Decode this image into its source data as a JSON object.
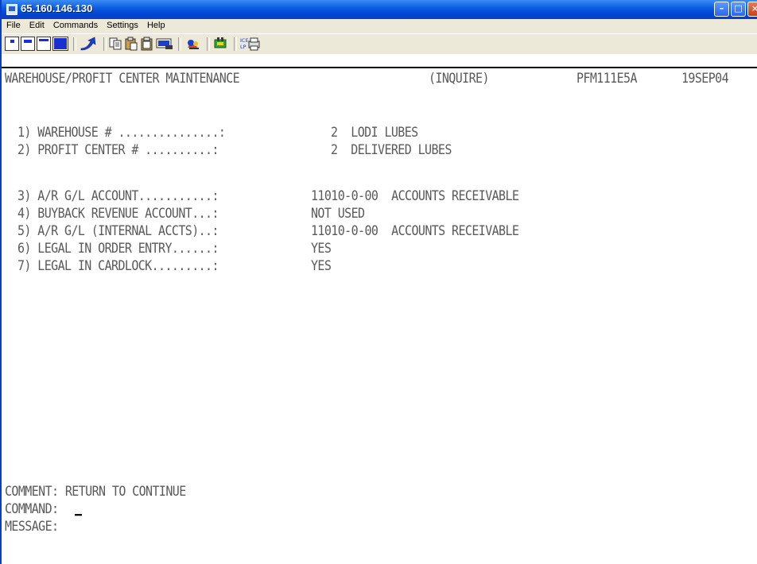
{
  "window": {
    "title": "65.160.146.130"
  },
  "menu": [
    "File",
    "Edit",
    "Commands",
    "Settings",
    "Help"
  ],
  "toolbar": {
    "icons": [
      "small-screen-icon",
      "medium-screen-icon",
      "large-screen-icon",
      "full-screen-icon",
      "send-arrow-icon",
      "copy-icon",
      "paste-icon",
      "clipboard-icon",
      "keyboard-map-icon",
      "macro-icon",
      "hotspot-icon",
      "print-icon"
    ],
    "print_label": "ICE LP"
  },
  "screen": {
    "header_title": "WAREHOUSE/PROFIT CENTER MAINTENANCE",
    "mode": "(INQUIRE)",
    "program_id": "PFM111E5A",
    "date": "19SEP04",
    "fields": [
      {
        "label": "1) WAREHOUSE # ...............:",
        "value": "2  LODI LUBES"
      },
      {
        "label": "2) PROFIT CENTER # ..........:",
        "value": "2  DELIVERED LUBES"
      },
      {
        "label": "3) A/R G/L ACCOUNT...........:",
        "value": "11010-0-00  ACCOUNTS RECEIVABLE"
      },
      {
        "label": "4) BUYBACK REVENUE ACCOUNT...:",
        "value": "NOT USED"
      },
      {
        "label": "5) A/R G/L (INTERNAL ACCTS)..:",
        "value": "11010-0-00  ACCOUNTS RECEIVABLE"
      },
      {
        "label": "6) LEGAL IN ORDER ENTRY......:",
        "value": "YES"
      },
      {
        "label": "7) LEGAL IN CARDLOCK.........:",
        "value": "YES"
      }
    ],
    "comment": "COMMENT: RETURN TO CONTINUE",
    "command_label": "COMMAND:",
    "command_value": "",
    "message_label": "MESSAGE:"
  }
}
